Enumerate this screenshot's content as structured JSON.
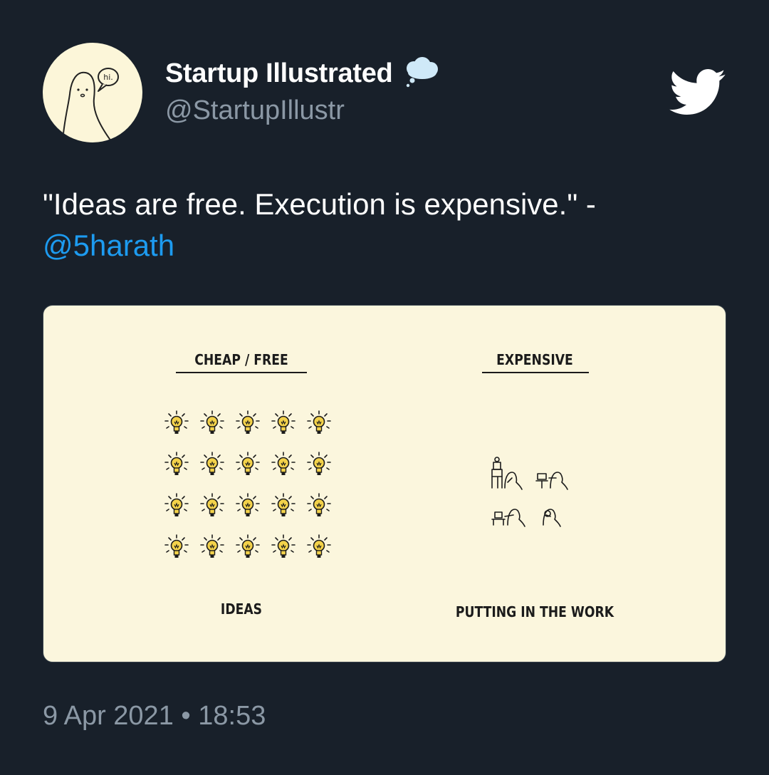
{
  "author": {
    "display_name": "Startup Illustrated",
    "handle": "@StartupIllustr",
    "avatar_speech_text": "hi.",
    "badge_icon": "thought-bubble-icon"
  },
  "platform_icon": "twitter-bird-icon",
  "tweet": {
    "text": "\"Ideas are free. Execution is expensive.\" -",
    "mention": "@5harath"
  },
  "illustration": {
    "left_header": "CHEAP / FREE",
    "right_header": "EXPENSIVE",
    "left_caption": "IDEAS",
    "right_caption": "PUTTING IN THE WORK",
    "bulb_count": 20
  },
  "meta": {
    "date": "9 Apr 2021",
    "separator": "•",
    "time": "18:53"
  },
  "colors": {
    "background": "#18202a",
    "link": "#1d9bf0",
    "muted": "#8b98a5",
    "illustration_bg": "#fbf6dd",
    "bulb": "#f3d24a"
  }
}
